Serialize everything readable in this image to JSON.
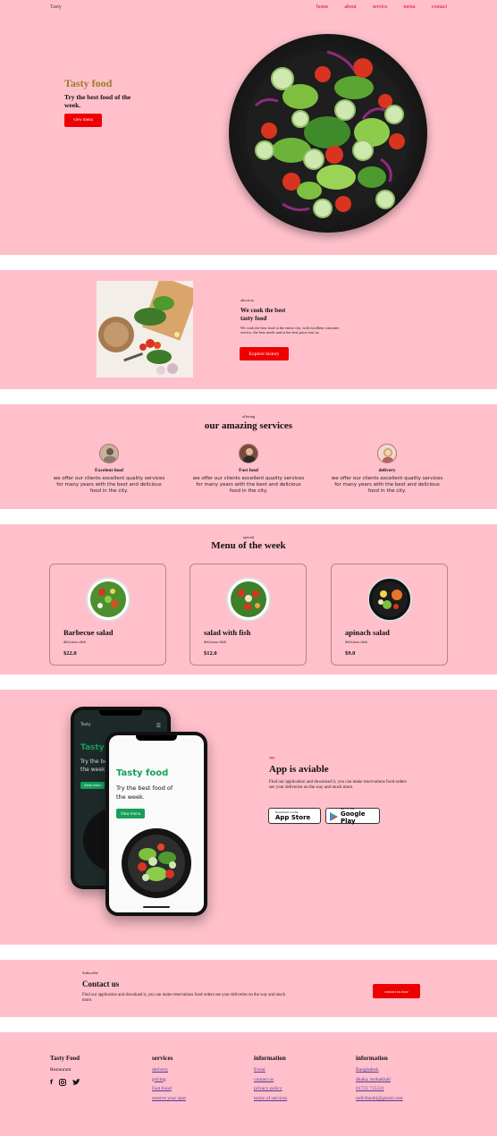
{
  "nav": {
    "logo": "Tasty",
    "links": [
      "home",
      "about",
      "servics",
      "menu",
      "contact"
    ]
  },
  "hero": {
    "title": "Tasty food",
    "subtitle": "Try the best food of the week.",
    "button": "view menu"
  },
  "about": {
    "label": "about us",
    "title": "We cook the best tasty food",
    "text": "We cook the best food in the entire city, with excellent customer service, the best meals and at the best price,visit us.",
    "button": "Explore history"
  },
  "services": {
    "label": "offering",
    "title": "our amazing services",
    "items": [
      {
        "title": "Excelent food",
        "desc": "we offer our clients excellent quality services for many years with the best and delicious food in the city."
      },
      {
        "title": "Fast food",
        "desc": "we offer our clients excellent quality services for many years with the best and delicious food in the city."
      },
      {
        "title": "delivery",
        "desc": "we offer our clients excellent quality services for many years with the best and delicious food in the city."
      }
    ]
  },
  "menu": {
    "label": "special",
    "title": "Menu of the week",
    "items": [
      {
        "name": "Barbecue salad",
        "type": "delicious dish",
        "price": "$22.0"
      },
      {
        "name": "salad with fish",
        "type": "delicious dish",
        "price": "$12.0"
      },
      {
        "name": "apinach salad",
        "type": "delicious dish",
        "price": "$9.0"
      }
    ]
  },
  "app": {
    "label": "app",
    "title": "App is aviable",
    "text": "Find our application and download it, you can make reservations food orders see your deliveries on the way and much more.",
    "phone_logo": "Tasty",
    "phone_title": "Tasty food",
    "phone_sub": "Try the best food of the week.",
    "phone_button": "View menu",
    "appstore_small": "Download on the",
    "appstore_big": "App Store",
    "googleplay_small": "GET IT ON",
    "googleplay_big": "Google Play"
  },
  "contact": {
    "label": "Subscribe",
    "title": "Contact us",
    "text": "Find our application and download it, you can make reservations food orders see your deliveries on the way and much more.",
    "button": "contact us now"
  },
  "footer": {
    "col1": {
      "title": "Tasty Food",
      "sub": "Restaurant"
    },
    "col2": {
      "title": "services",
      "links": [
        "delivery",
        "pricing",
        "Fast Food",
        "reserve your spot"
      ]
    },
    "col3": {
      "title": "information",
      "links": [
        "Event",
        "contact us",
        "privacy policy",
        "terms of services"
      ]
    },
    "col4": {
      "title": "information",
      "links": [
        "Bangladesh",
        "dhaka, mohakhali",
        "01722 715331",
        "mdirfanahi@gmail.com"
      ]
    }
  },
  "colors": {
    "band": "#ffc0cb",
    "accent_red": "#ee0000",
    "hero_title": "#9b7a2a",
    "phone_green": "#15a05a"
  },
  "icons": [
    "menu-icon",
    "facebook-icon",
    "instagram-icon",
    "twitter-icon",
    "apple-icon",
    "google-play-icon"
  ]
}
